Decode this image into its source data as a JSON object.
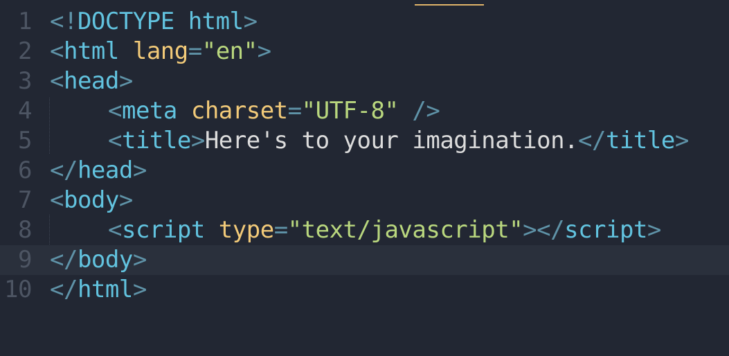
{
  "editor": {
    "accent_color": "#e0b46a",
    "background_color": "#222733",
    "active_line": 9,
    "lines": [
      {
        "number": "1",
        "tokens": [
          {
            "text": "<!",
            "kind": "punct"
          },
          {
            "text": "DOCTYPE html",
            "kind": "tag"
          },
          {
            "text": ">",
            "kind": "punct"
          }
        ]
      },
      {
        "number": "2",
        "tokens": [
          {
            "text": "<",
            "kind": "punct"
          },
          {
            "text": "html",
            "kind": "tag"
          },
          {
            "text": " ",
            "kind": "txt"
          },
          {
            "text": "lang",
            "kind": "attr"
          },
          {
            "text": "=",
            "kind": "punct"
          },
          {
            "text": "\"en\"",
            "kind": "str"
          },
          {
            "text": ">",
            "kind": "punct"
          }
        ]
      },
      {
        "number": "3",
        "tokens": [
          {
            "text": "<",
            "kind": "punct"
          },
          {
            "text": "head",
            "kind": "tag"
          },
          {
            "text": ">",
            "kind": "punct"
          }
        ]
      },
      {
        "number": "4",
        "indent": true,
        "tokens": [
          {
            "text": "<",
            "kind": "punct"
          },
          {
            "text": "meta",
            "kind": "tag"
          },
          {
            "text": " ",
            "kind": "txt"
          },
          {
            "text": "charset",
            "kind": "attr"
          },
          {
            "text": "=",
            "kind": "punct"
          },
          {
            "text": "\"UTF-8\"",
            "kind": "str"
          },
          {
            "text": " />",
            "kind": "punct"
          }
        ]
      },
      {
        "number": "5",
        "indent": true,
        "tokens": [
          {
            "text": "<",
            "kind": "punct"
          },
          {
            "text": "title",
            "kind": "tag"
          },
          {
            "text": ">",
            "kind": "punct"
          },
          {
            "text": "Here's to your imagination.",
            "kind": "txt"
          },
          {
            "text": "</",
            "kind": "punct"
          },
          {
            "text": "title",
            "kind": "tag"
          },
          {
            "text": ">",
            "kind": "punct"
          }
        ]
      },
      {
        "number": "6",
        "tokens": [
          {
            "text": "</",
            "kind": "punct"
          },
          {
            "text": "head",
            "kind": "tag"
          },
          {
            "text": ">",
            "kind": "punct"
          }
        ]
      },
      {
        "number": "7",
        "tokens": [
          {
            "text": "<",
            "kind": "punct"
          },
          {
            "text": "body",
            "kind": "tag"
          },
          {
            "text": ">",
            "kind": "punct"
          }
        ]
      },
      {
        "number": "8",
        "indent": true,
        "tokens": [
          {
            "text": "<",
            "kind": "punct"
          },
          {
            "text": "script",
            "kind": "tag"
          },
          {
            "text": " ",
            "kind": "txt"
          },
          {
            "text": "type",
            "kind": "attr"
          },
          {
            "text": "=",
            "kind": "punct"
          },
          {
            "text": "\"text/javascript\"",
            "kind": "str"
          },
          {
            "text": "></",
            "kind": "punct"
          },
          {
            "text": "script",
            "kind": "tag"
          },
          {
            "text": ">",
            "kind": "punct"
          }
        ]
      },
      {
        "number": "9",
        "tokens": [
          {
            "text": "</",
            "kind": "punct"
          },
          {
            "text": "body",
            "kind": "tag"
          },
          {
            "text": ">",
            "kind": "punct"
          }
        ]
      },
      {
        "number": "10",
        "tokens": [
          {
            "text": "</",
            "kind": "punct"
          },
          {
            "text": "html",
            "kind": "tag"
          },
          {
            "text": ">",
            "kind": "punct"
          }
        ]
      }
    ]
  }
}
